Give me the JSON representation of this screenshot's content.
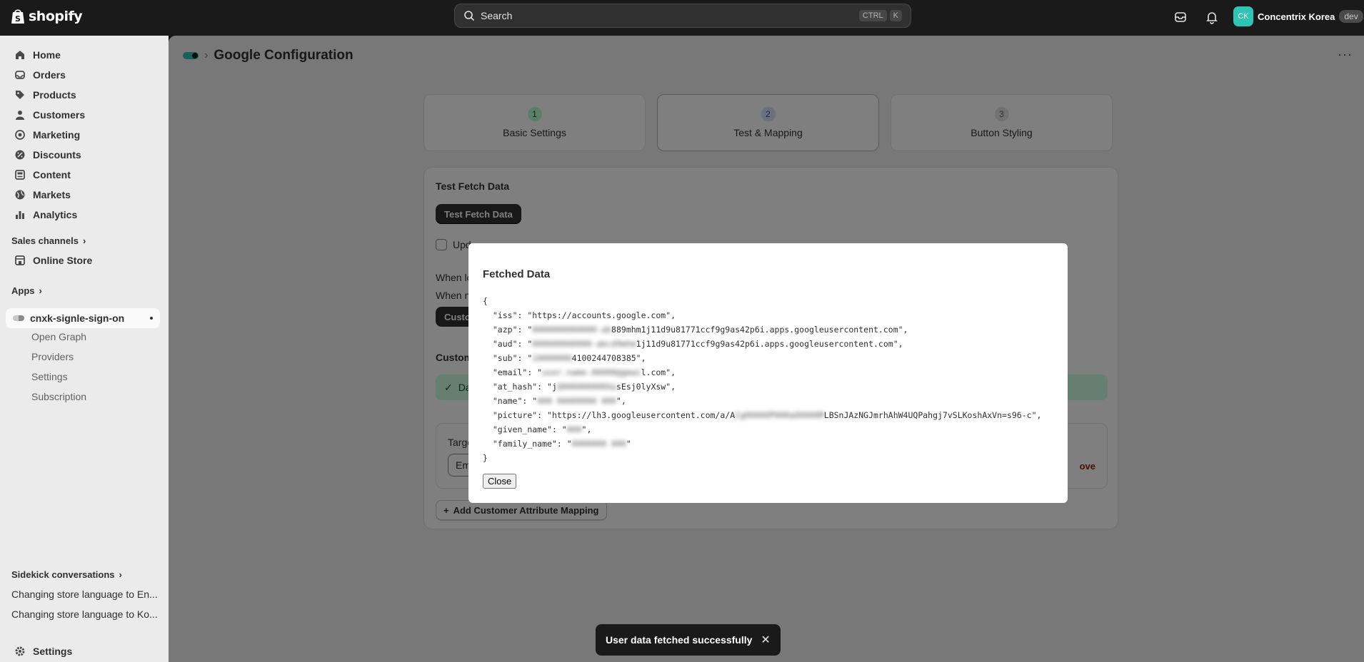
{
  "topbar": {
    "brand": "shopify",
    "search_placeholder": "Search",
    "search_keys": [
      "CTRL",
      "K"
    ],
    "store_initials": "CK",
    "store_name": "Concentrix Korea",
    "store_badge": "dev"
  },
  "sidebar": {
    "items": [
      {
        "label": "Home",
        "icon": "home-icon"
      },
      {
        "label": "Orders",
        "icon": "inbox-icon"
      },
      {
        "label": "Products",
        "icon": "tag-icon"
      },
      {
        "label": "Customers",
        "icon": "person-icon"
      },
      {
        "label": "Marketing",
        "icon": "target-icon"
      },
      {
        "label": "Discounts",
        "icon": "discount-icon"
      },
      {
        "label": "Content",
        "icon": "content-icon"
      },
      {
        "label": "Markets",
        "icon": "globe-icon"
      },
      {
        "label": "Analytics",
        "icon": "bar-chart-icon"
      }
    ],
    "sales_channels_label": "Sales channels",
    "online_store_label": "Online Store",
    "apps_label": "Apps",
    "active_app": "cnxk-signle-sign-on",
    "app_sub_items": [
      "Open Graph",
      "Providers",
      "Settings",
      "Subscription"
    ],
    "sidekick_label": "Sidekick conversations",
    "sidekick_items": [
      "Changing store language to En...",
      "Changing store language to Ko..."
    ],
    "settings_label": "Settings"
  },
  "page": {
    "title": "Google Configuration",
    "steps": [
      {
        "num": "1",
        "label": "Basic Settings"
      },
      {
        "num": "2",
        "label": "Test & Mapping"
      },
      {
        "num": "3",
        "label": "Button Styling"
      }
    ],
    "card_title": "Test Fetch Data",
    "fetch_button": "Test Fetch Data",
    "checkbox_label": "Upd",
    "text_1": "When lo",
    "text_2": "When n",
    "custom_button": "Custo",
    "custom_section": "Custom",
    "banner_text": "Da",
    "target_label": "Targe",
    "target_value": "Em",
    "remove_label": "ove",
    "add_mapping": "Add Customer Attribute Mapping"
  },
  "modal": {
    "title": "Fetched Data",
    "open_brace": "{",
    "close_brace": "}",
    "lines": [
      {
        "key": "iss",
        "pre": "https://accounts.google.com",
        "blur": "",
        "post": ""
      },
      {
        "key": "azp",
        "pre": "",
        "blur": "0000000000000-ab",
        "post": "889mhm1j11d9u81771ccf9g9as42p6i.apps.googleusercontent.com"
      },
      {
        "key": "aud",
        "pre": "",
        "blur": "000000000000-abcd9mhm",
        "post": "1j11d9u81771ccf9g9as42p6i.apps.googleusercontent.com"
      },
      {
        "key": "sub",
        "pre": "",
        "blur": "10000000",
        "post": "4100244708385"
      },
      {
        "key": "email",
        "pre": "",
        "blur": "user.name.00000@gmai",
        "post": "l.com"
      },
      {
        "key": "at_hash",
        "pre": "j",
        "blur": "Q000000000Xa",
        "post": "sEsj0lyXsw"
      },
      {
        "key": "name",
        "pre": "",
        "blur": "000 00000000 000",
        "post": ""
      },
      {
        "key": "picture",
        "pre": "https://lh3.googleusercontent.com/a/A",
        "blur": "CgOOOOOP000aOOOOOM",
        "post": "LBSnJAzNGJmrhAhW4UQPahgj7vSLKoshAxVn=s96-c"
      },
      {
        "key": "given_name",
        "pre": "",
        "blur": "000",
        "post": ""
      },
      {
        "key": "family_name",
        "pre": "",
        "blur": "0000000 000",
        "post": ""
      }
    ],
    "close_button": "Close"
  },
  "toast": {
    "message": "User data fetched successfully"
  },
  "colors": {
    "accent": "#2ec4b6",
    "topbar": "#1a1a1a",
    "sidebar": "#ebebeb"
  }
}
